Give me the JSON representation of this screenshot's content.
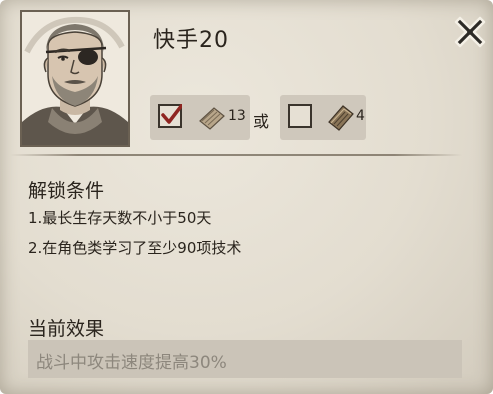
{
  "skill": {
    "name": "快手20"
  },
  "cost": {
    "option1": {
      "checked": true,
      "item_icon": "scroll-icon",
      "count": "13"
    },
    "or_label": "或",
    "option2": {
      "checked": false,
      "item_icon": "book-icon",
      "count": "4"
    }
  },
  "unlock": {
    "title": "解锁条件",
    "conditions": [
      "1.最长生存天数不小于50天",
      "2.在角色类学习了至少90项技术"
    ]
  },
  "effect": {
    "title": "当前效果",
    "text": "战斗中攻击速度提高30%"
  },
  "icons": {
    "close": "close-icon",
    "portrait": "character-portrait"
  }
}
